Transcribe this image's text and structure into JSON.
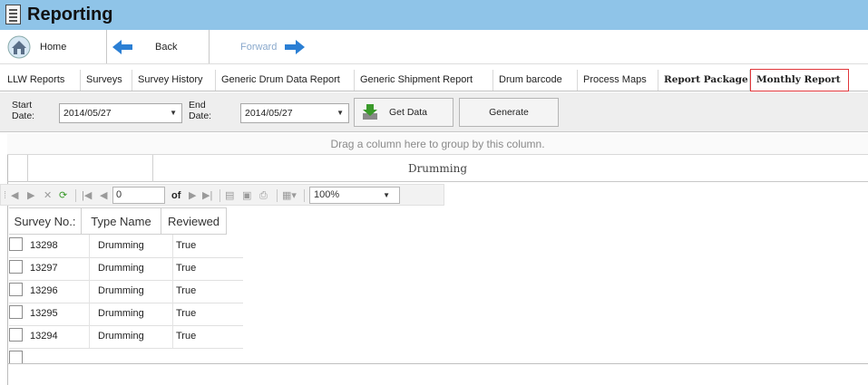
{
  "window": {
    "title": "Reporting"
  },
  "nav": {
    "home": "Home",
    "back": "Back",
    "forward": "Forward"
  },
  "tabs": [
    {
      "label": "LLW Reports"
    },
    {
      "label": "Surveys"
    },
    {
      "label": "Survey History"
    },
    {
      "label": "Generic Drum Data Report"
    },
    {
      "label": "Generic Shipment Report"
    },
    {
      "label": "Drum barcode"
    },
    {
      "label": "Process Maps"
    },
    {
      "label": "Report Package"
    },
    {
      "label": "Monthly Report"
    }
  ],
  "filter": {
    "start_label_1": "Start",
    "start_label_2": "Date:",
    "start_date": "2014/05/27",
    "end_label_1": "End",
    "end_label_2": "Date:",
    "end_date": "2014/05/27",
    "get_data": "Get Data",
    "generate": "Generate"
  },
  "grid": {
    "group_hint": "Drag a column here to group by this column.",
    "band_title": "Drumming"
  },
  "report_toolbar": {
    "page": "0",
    "of_label": "of",
    "zoom": "100%"
  },
  "report": {
    "headers": [
      "Survey No.:",
      "Type Name",
      "Reviewed"
    ],
    "rows": [
      {
        "survey_no": "13298",
        "type_name": "Drumming",
        "reviewed": "True"
      },
      {
        "survey_no": "13297",
        "type_name": "Drumming",
        "reviewed": "True"
      },
      {
        "survey_no": "13296",
        "type_name": "Drumming",
        "reviewed": "True"
      },
      {
        "survey_no": "13295",
        "type_name": "Drumming",
        "reviewed": "True"
      },
      {
        "survey_no": "13294",
        "type_name": "Drumming",
        "reviewed": "True"
      }
    ]
  },
  "colors": {
    "titlebar": "#8fc4e8",
    "active_tab_border": "#e0363a",
    "nav_arrow": "#2b7fd4",
    "get_data_icon": "#3a9a2a"
  }
}
